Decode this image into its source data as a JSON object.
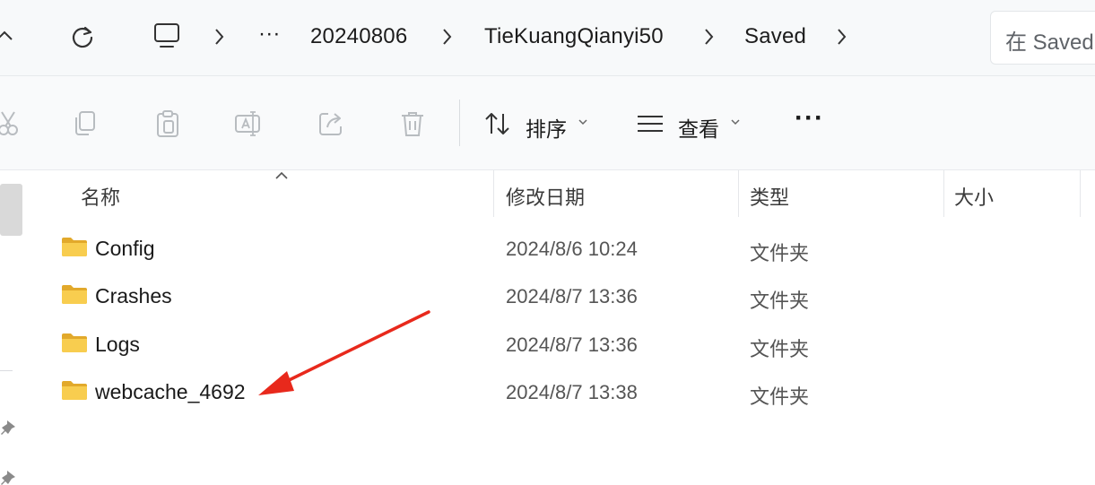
{
  "breadcrumb": {
    "overflow": "···",
    "items": [
      "20240806",
      "TieKuangQianyi50",
      "Saved"
    ]
  },
  "search": {
    "placeholder": "在 Saved"
  },
  "toolbar": {
    "sort_label": "排序",
    "view_label": "查看",
    "more_label": "···"
  },
  "columns": {
    "name": "名称",
    "modified": "修改日期",
    "type": "类型",
    "size": "大小"
  },
  "rows": [
    {
      "name": "Config",
      "modified": "2024/8/6 10:24",
      "type": "文件夹"
    },
    {
      "name": "Crashes",
      "modified": "2024/8/7 13:36",
      "type": "文件夹"
    },
    {
      "name": "Logs",
      "modified": "2024/8/7 13:36",
      "type": "文件夹"
    },
    {
      "name": "webcache_4692",
      "modified": "2024/8/7 13:38",
      "type": "文件夹"
    }
  ],
  "colors": {
    "folder": "#f4c542",
    "annotation_arrow": "#e8291c"
  },
  "icons": [
    "up-arrow-icon",
    "refresh-icon",
    "computer-icon",
    "chevron-right-icon",
    "cut-icon",
    "copy-icon",
    "paste-icon",
    "rename-icon",
    "share-icon",
    "delete-icon",
    "sort-icon",
    "view-icon",
    "folder-icon",
    "pin-icon",
    "sort-ascending-indicator-icon"
  ]
}
